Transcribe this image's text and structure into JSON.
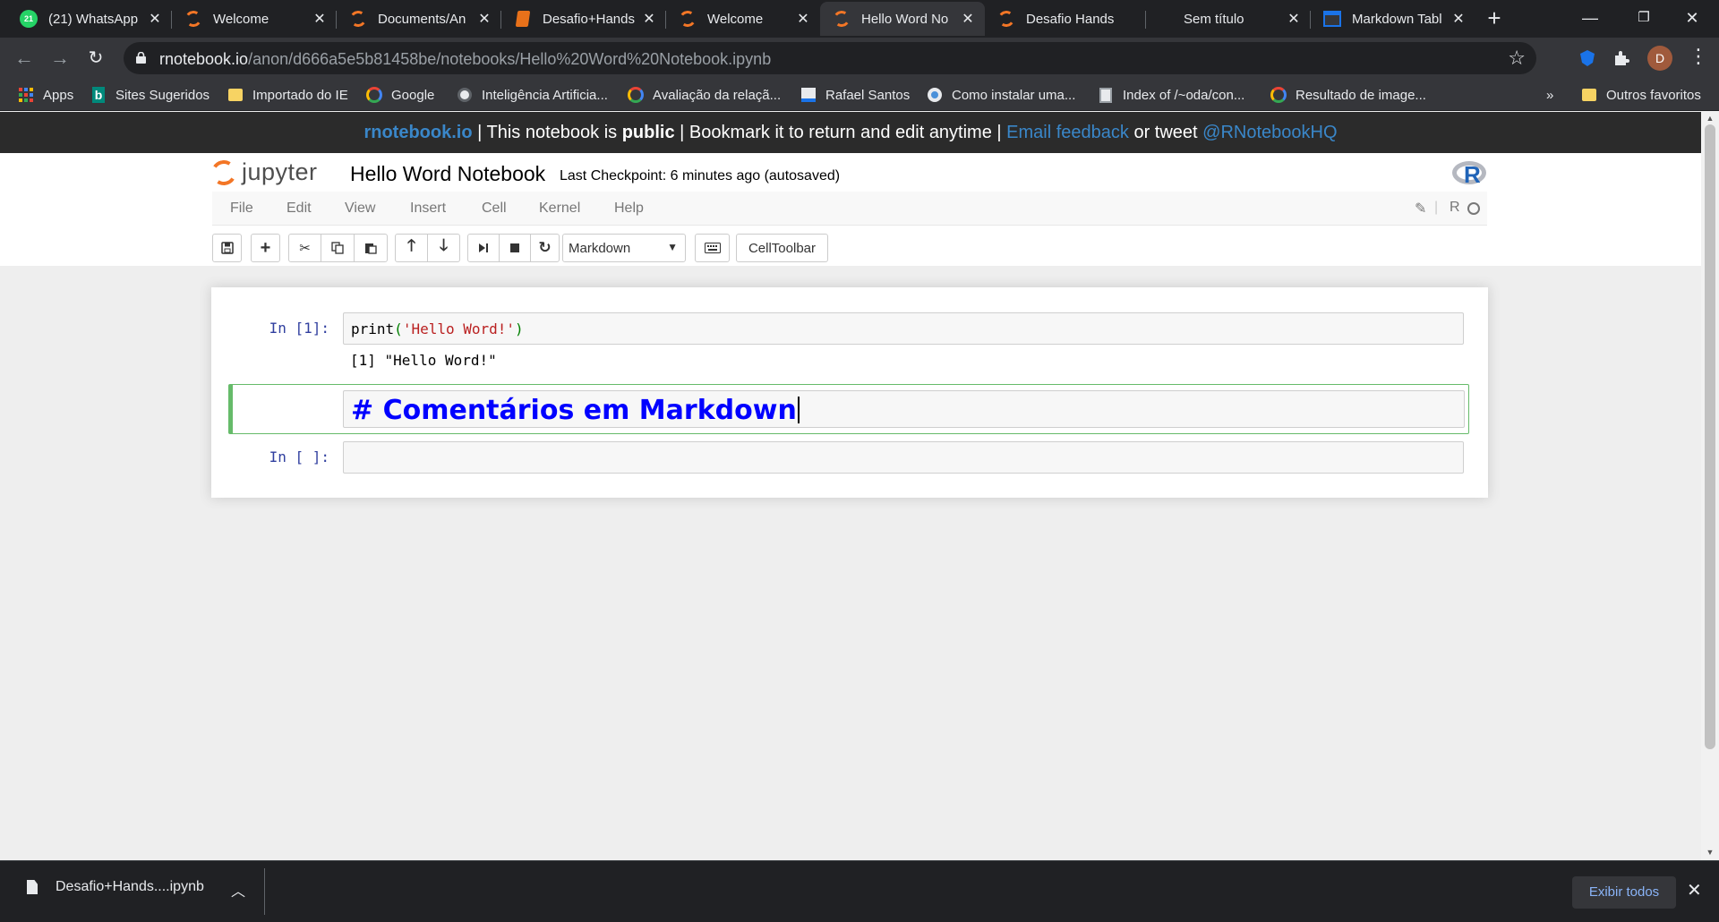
{
  "browser": {
    "tabs": [
      {
        "title": "(21) WhatsApp",
        "icon": "whatsapp-icon",
        "badge": "21"
      },
      {
        "title": "Welcome",
        "icon": "jupyter-icon"
      },
      {
        "title": "Documents/An",
        "icon": "jupyter-icon"
      },
      {
        "title": "Desafio+Hands",
        "icon": "document-icon"
      },
      {
        "title": "Welcome",
        "icon": "jupyter-icon"
      },
      {
        "title": "Hello Word No",
        "icon": "jupyter-icon",
        "active": true
      },
      {
        "title": "Desafio Hands",
        "icon": "jupyter-icon"
      },
      {
        "title": "Sem título",
        "icon": "blank-icon"
      },
      {
        "title": "Markdown Tabl",
        "icon": "table-icon"
      }
    ],
    "url_host": "rnotebook.io",
    "url_path": "/anon/d666a5e5b81458be/notebooks/Hello%20Word%20Notebook.ipynb",
    "profile_initial": "D",
    "bookmarks": [
      {
        "label": "Apps",
        "icon": "apps-grid-icon"
      },
      {
        "label": "Sites Sugeridos",
        "icon": "bing-icon"
      },
      {
        "label": "Importado do IE",
        "icon": "folder-icon"
      },
      {
        "label": "Google",
        "icon": "google-icon"
      },
      {
        "label": "Inteligência Artificia...",
        "icon": "globe-icon"
      },
      {
        "label": "Avaliação da relaçã...",
        "icon": "google-icon"
      },
      {
        "label": "Rafael Santos",
        "icon": "site-icon"
      },
      {
        "label": "Como instalar uma...",
        "icon": "gear-icon"
      },
      {
        "label": "Index of /~oda/con...",
        "icon": "file-icon"
      },
      {
        "label": "Resultado de image...",
        "icon": "google-icon"
      }
    ],
    "bookmarks_overflow": "»",
    "other_bookmarks": "Outros favoritos"
  },
  "banner": {
    "brand": "rnotebook.io",
    "text1": " | This notebook is ",
    "bold": "public",
    "text2": " | Bookmark it to return and edit anytime | ",
    "feedback": "Email feedback",
    "text3": " or tweet ",
    "twitter": "@RNotebookHQ"
  },
  "notebook": {
    "logo_text": "jupyter",
    "title": "Hello Word Notebook",
    "checkpoint": "Last Checkpoint: 6 minutes ago (autosaved)",
    "kernel_logo": "R",
    "menu": [
      "File",
      "Edit",
      "View",
      "Insert",
      "Cell",
      "Kernel",
      "Help"
    ],
    "kernel_name": "R",
    "cell_type": "Markdown",
    "celltoolbar_label": "CellToolbar",
    "cells": [
      {
        "prompt": "In [1]:",
        "code_fn": "print",
        "code_open": "(",
        "code_str": "'Hello Word!'",
        "code_close": ")",
        "output": "[1] \"Hello Word!\""
      },
      {
        "markdown": "# Comentários em Markdown"
      },
      {
        "prompt": "In [ ]:",
        "code": ""
      }
    ]
  },
  "downloads": {
    "file": "Desafio+Hands....ipynb",
    "show_all": "Exibir todos"
  },
  "colors": {
    "accent_jupyter": "#f37626",
    "link_blue": "#3a87c9",
    "markdown_blue": "#0000ff",
    "selected_green": "#66bb6a"
  }
}
